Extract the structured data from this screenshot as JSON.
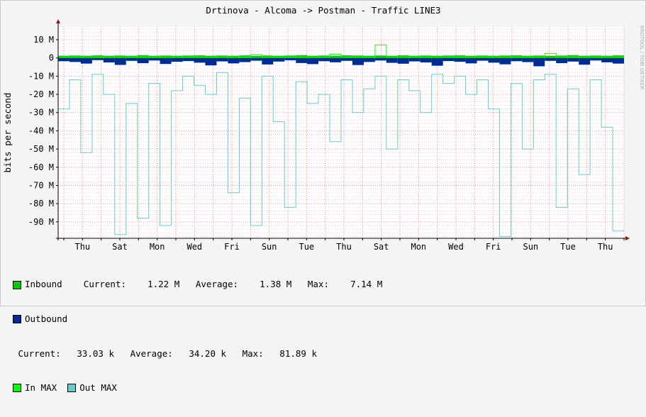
{
  "title": "Drtinova - Alcoma -> Postman - Traffic LINE3",
  "watermark": "RRDTOOL / TOBI OETIKER",
  "colors": {
    "background": "#f4f4f4",
    "canvas": "#ffffff",
    "grid_minor": "#f0c8c8",
    "grid_major": "#e89090",
    "inbound": "#00cc00",
    "outbound": "#002a97",
    "in_max": "#00ff00",
    "out_max": "#66cccc",
    "arrow": "#a01010"
  },
  "chart_data": {
    "type": "area",
    "title": "Drtinova - Alcoma -> Postman - Traffic LINE3",
    "ylabel": "bits per second",
    "ylim": [
      -99,
      17
    ],
    "yticks": [
      10,
      0,
      -10,
      -20,
      -30,
      -40,
      -50,
      -60,
      -70,
      -80,
      -90
    ],
    "ytick_labels": [
      "10 M",
      "0",
      "-10 M",
      "-20 M",
      "-30 M",
      "-40 M",
      "-50 M",
      "-60 M",
      "-70 M",
      "-80 M",
      "-90 M"
    ],
    "xtick_labels": [
      "Thu",
      "Sat",
      "Mon",
      "Wed",
      "Fri",
      "Sun",
      "Tue",
      "Thu",
      "Sat",
      "Mon",
      "Wed",
      "Fri",
      "Sun",
      "Tue",
      "Thu"
    ],
    "grid": true,
    "series": [
      {
        "name": "Inbound",
        "unit": "M bits/s",
        "values": [
          1.2,
          1.3,
          1.2,
          1.4,
          1.2,
          1.3,
          1.2,
          1.5,
          1.2,
          1.3,
          1.2,
          1.3,
          1.4,
          1.2,
          1.3,
          1.2,
          1.4,
          1.2,
          1.3,
          1.2,
          1.3,
          1.5,
          1.2,
          1.3,
          1.2,
          1.4,
          1.3,
          1.2,
          1.3,
          1.2,
          1.4,
          1.2,
          1.3,
          1.2,
          1.3,
          1.4,
          1.2,
          1.3,
          1.2,
          1.3,
          1.4,
          1.2,
          1.3,
          1.2,
          1.3,
          1.5,
          1.2,
          1.3,
          1.2,
          1.4
        ]
      },
      {
        "name": "Outbound",
        "unit": "M bits/s",
        "values": [
          -1.8,
          -2.2,
          -3.1,
          -1.2,
          -2.5,
          -3.8,
          -1.6,
          -2.9,
          -1.4,
          -3.3,
          -2.1,
          -1.7,
          -2.6,
          -4.1,
          -1.9,
          -3.0,
          -2.3,
          -1.5,
          -3.6,
          -2.0,
          -1.3,
          -2.8,
          -3.4,
          -1.8,
          -2.4,
          -1.6,
          -3.9,
          -2.2,
          -1.4,
          -2.7,
          -3.2,
          -1.9,
          -2.5,
          -4.3,
          -1.7,
          -2.1,
          -3.0,
          -1.5,
          -2.6,
          -3.5,
          -1.8,
          -2.3,
          -4.6,
          -1.6,
          -2.9,
          -2.0,
          -3.7,
          -1.4,
          -2.4,
          -3.1
        ]
      },
      {
        "name": "In MAX",
        "unit": "M bits/s",
        "values": [
          0.5,
          0.5,
          0.5,
          0.5,
          0.5,
          0.5,
          0.5,
          0.5,
          0.5,
          0.5,
          0.5,
          0.5,
          0.5,
          0.5,
          0.5,
          0.5,
          0.5,
          1.8,
          0.5,
          0.5,
          0.5,
          0.5,
          0.5,
          0.5,
          2.1,
          0.5,
          0.5,
          0.5,
          7.1,
          0.5,
          0.5,
          0.5,
          0.5,
          0.5,
          0.5,
          0.5,
          0.5,
          0.5,
          0.5,
          0.5,
          0.5,
          0.5,
          0.5,
          2.5,
          0.5,
          0.5,
          0.5,
          0.5,
          0.5,
          0.5
        ]
      },
      {
        "name": "Out MAX",
        "unit": "M bits/s",
        "values": [
          -28,
          -12,
          -52,
          -9,
          -20,
          -97,
          -25,
          -88,
          -14,
          -92,
          -18,
          -10,
          -15,
          -20,
          -8,
          -74,
          -22,
          -92,
          -10,
          -35,
          -82,
          -13,
          -25,
          -20,
          -46,
          -12,
          -30,
          -17,
          -10,
          -50,
          -12,
          -18,
          -30,
          -9,
          -14,
          -10,
          -20,
          -12,
          -28,
          -98,
          -14,
          -50,
          -12,
          -9,
          -82,
          -17,
          -64,
          -12,
          -38,
          -95
        ]
      }
    ]
  },
  "legend": {
    "inbound_label": "Inbound",
    "inbound_stats": "Current:    1.22 M   Average:    1.38 M   Max:    7.14 M",
    "outbound_label": "Outbound",
    "outbound_stats": "Current:   33.03 k   Average:   34.20 k   Max:   81.89 k",
    "in_max_label": "In MAX",
    "out_max_label": "Out MAX"
  }
}
